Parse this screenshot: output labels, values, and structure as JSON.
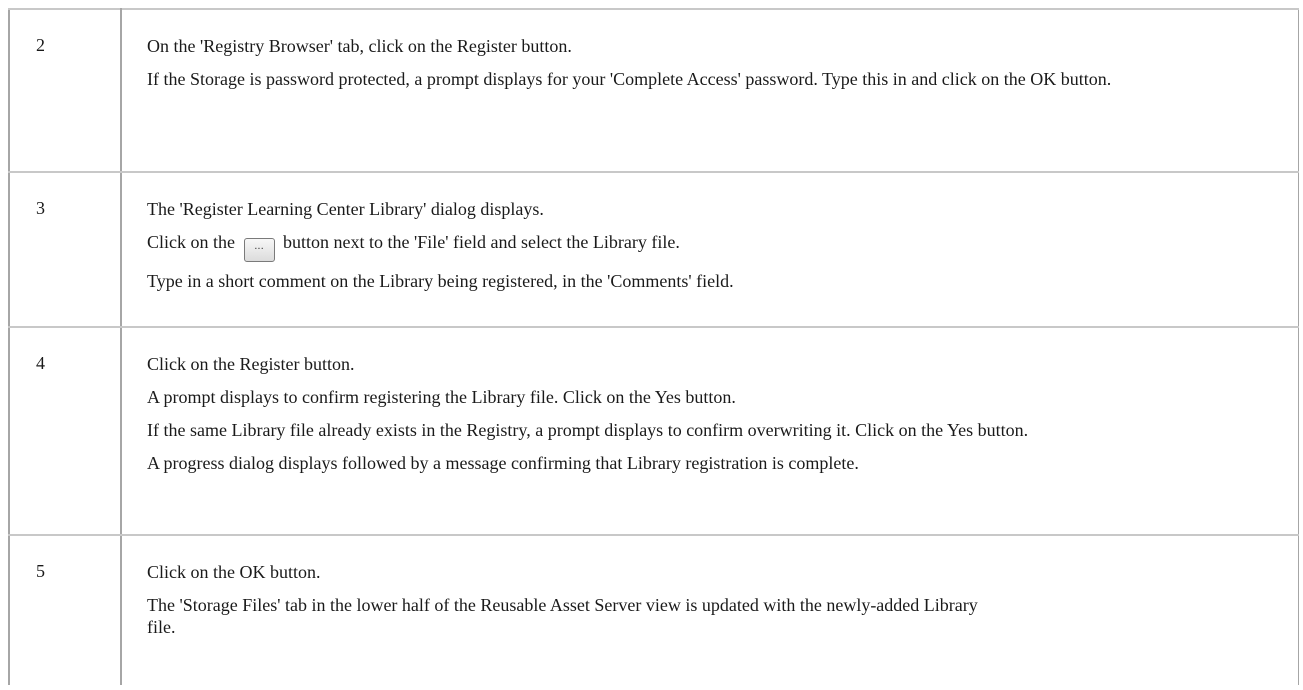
{
  "steps": [
    {
      "number": "2",
      "lines": [
        "On the 'Registry Browser' tab, click on the Register button.",
        "If the Storage is password protected, a prompt displays for your 'Complete Access' password. Type this in and click on the OK button."
      ]
    },
    {
      "number": "3",
      "lines": [
        "The 'Register Learning Center Library' dialog displays.",
        "Type in a short comment on the Library being registered, in the 'Comments' field."
      ],
      "browse_line": {
        "before": "Click on the",
        "button_label": "...",
        "button_icon": "ellipsis-browse-button",
        "after": "button next to the 'File' field and select the Library file."
      }
    },
    {
      "number": "4",
      "lines": [
        "Click on the Register button.",
        "A prompt displays to confirm registering the Library file. Click on the Yes button.",
        "If the same Library file already exists in the Registry, a prompt displays to confirm overwriting it. Click on the Yes button.",
        "A progress dialog displays followed by a message confirming that Library registration is complete."
      ]
    },
    {
      "number": "5",
      "lines": [
        "Click on the OK button.",
        "The 'Storage Files' tab in the lower half of the Reusable Asset Server view is updated with the newly-added Library file."
      ]
    }
  ]
}
